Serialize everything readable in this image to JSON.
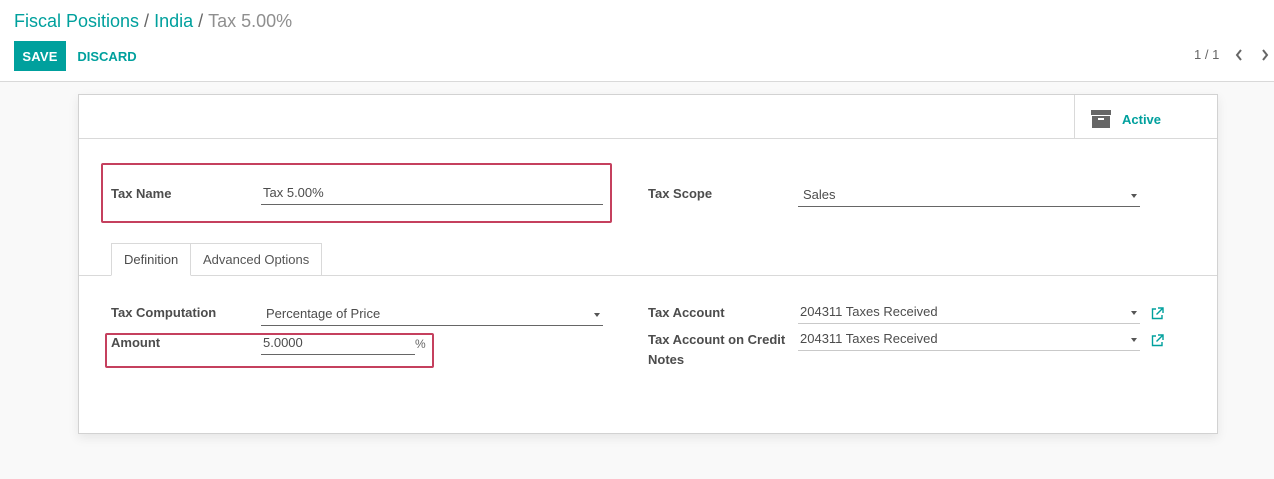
{
  "breadcrumb": {
    "items": [
      "Fiscal Positions",
      "India"
    ],
    "separator": "/",
    "current": "Tax 5.00%"
  },
  "toolbar": {
    "save_label": "SAVE",
    "discard_label": "DISCARD"
  },
  "pager": {
    "value": "1 / 1"
  },
  "status": {
    "active_label": "Active"
  },
  "form": {
    "tax_name_label": "Tax Name",
    "tax_name_value": "Tax 5.00%",
    "tax_scope_label": "Tax Scope",
    "tax_scope_value": "Sales"
  },
  "tabs": [
    {
      "label": "Definition",
      "active": true
    },
    {
      "label": "Advanced Options",
      "active": false
    }
  ],
  "definition": {
    "tax_computation_label": "Tax Computation",
    "tax_computation_value": "Percentage of Price",
    "amount_label": "Amount",
    "amount_value": "5.0000",
    "amount_unit": "%",
    "tax_account_label": "Tax Account",
    "tax_account_value": "204311 Taxes Received",
    "tax_account_credit_label_line1": "Tax Account on Credit",
    "tax_account_credit_label_line2": "Notes",
    "tax_account_credit_value": "204311 Taxes Received"
  },
  "colors": {
    "accent": "#00a09d",
    "highlight": "#c5405e"
  },
  "icons": {
    "archive": "archive-icon",
    "pager_prev": "chevron-left-icon",
    "pager_next": "chevron-right-icon",
    "external": "external-link-icon"
  }
}
